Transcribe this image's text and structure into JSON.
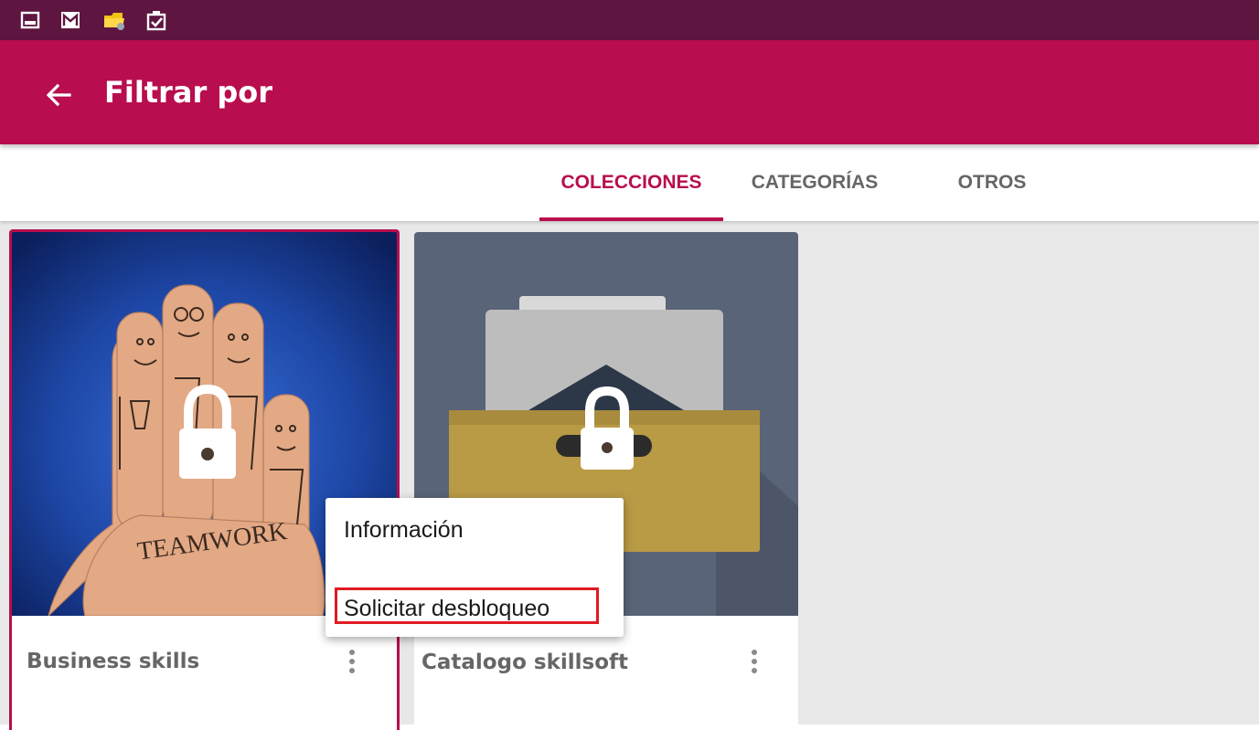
{
  "app_bar": {
    "title": "Filtrar por",
    "back_icon": "arrow-left-icon",
    "color": "#b80d4e"
  },
  "status_bar": {
    "color": "#5e1540",
    "icons": [
      "image-icon",
      "mail-icon",
      "file-folder-icon",
      "clipboard-check-icon"
    ]
  },
  "tabs": [
    {
      "label": "COLECCIONES",
      "active": true
    },
    {
      "label": "CATEGORÍAS",
      "active": false
    },
    {
      "label": "OTROS",
      "active": false
    }
  ],
  "cards": [
    {
      "title": "Business skills",
      "image_text": "TEAMWORK",
      "locked": true,
      "selected": true
    },
    {
      "title": "Catalogo skillsoft",
      "locked": true,
      "selected": false
    }
  ],
  "context_menu": {
    "items": [
      {
        "label": "Información"
      },
      {
        "label": "Solicitar desbloqueo",
        "highlighted": true
      }
    ],
    "highlight_color": "#e01a22"
  }
}
